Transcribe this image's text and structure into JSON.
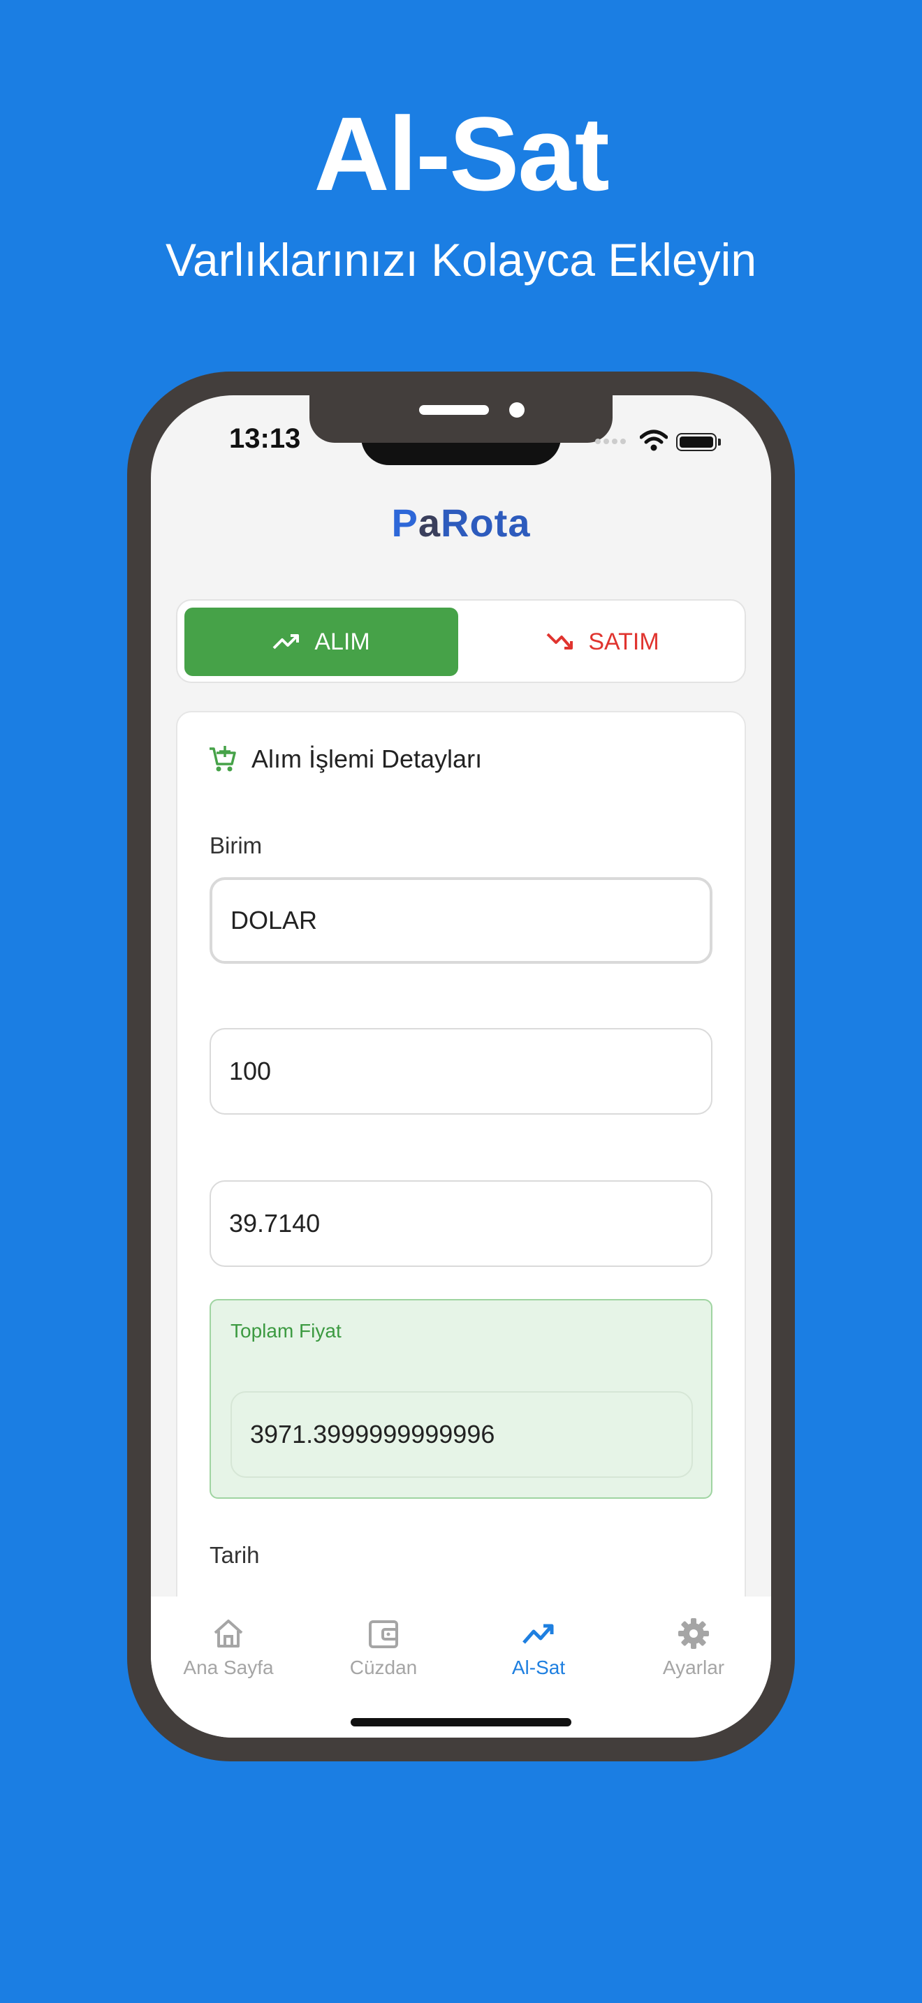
{
  "hero": {
    "title": "Al-Sat",
    "subtitle": "Varlıklarınızı Kolayca Ekleyin"
  },
  "status_bar": {
    "time": "13:13"
  },
  "brand": {
    "p1": "P",
    "p2": "a",
    "p3": "Rota"
  },
  "toggle": {
    "buy_label": "ALIM",
    "sell_label": "SATIM",
    "buy_icon": "trending-up-icon",
    "sell_icon": "trending-down-icon"
  },
  "card": {
    "title": "Alım İşlemi Detayları",
    "title_icon": "cart-plus-icon",
    "unit_label": "Birim",
    "unit_value": "DOLAR",
    "amount_value": "100",
    "price_value": "39.7140",
    "total_label": "Toplam Fiyat",
    "total_value": "3971.3999999999996",
    "date_label": "Tarih"
  },
  "nav": [
    {
      "label": "Ana Sayfa",
      "icon": "home-icon"
    },
    {
      "label": "Cüzdan",
      "icon": "wallet-icon"
    },
    {
      "label": "Al-Sat",
      "icon": "trending-up-icon"
    },
    {
      "label": "Ayarlar",
      "icon": "gear-icon"
    }
  ],
  "colors": {
    "background": "#1b7ee3",
    "buy": "#46a248",
    "sell": "#e0342f",
    "active_nav": "#1e7fe0"
  }
}
